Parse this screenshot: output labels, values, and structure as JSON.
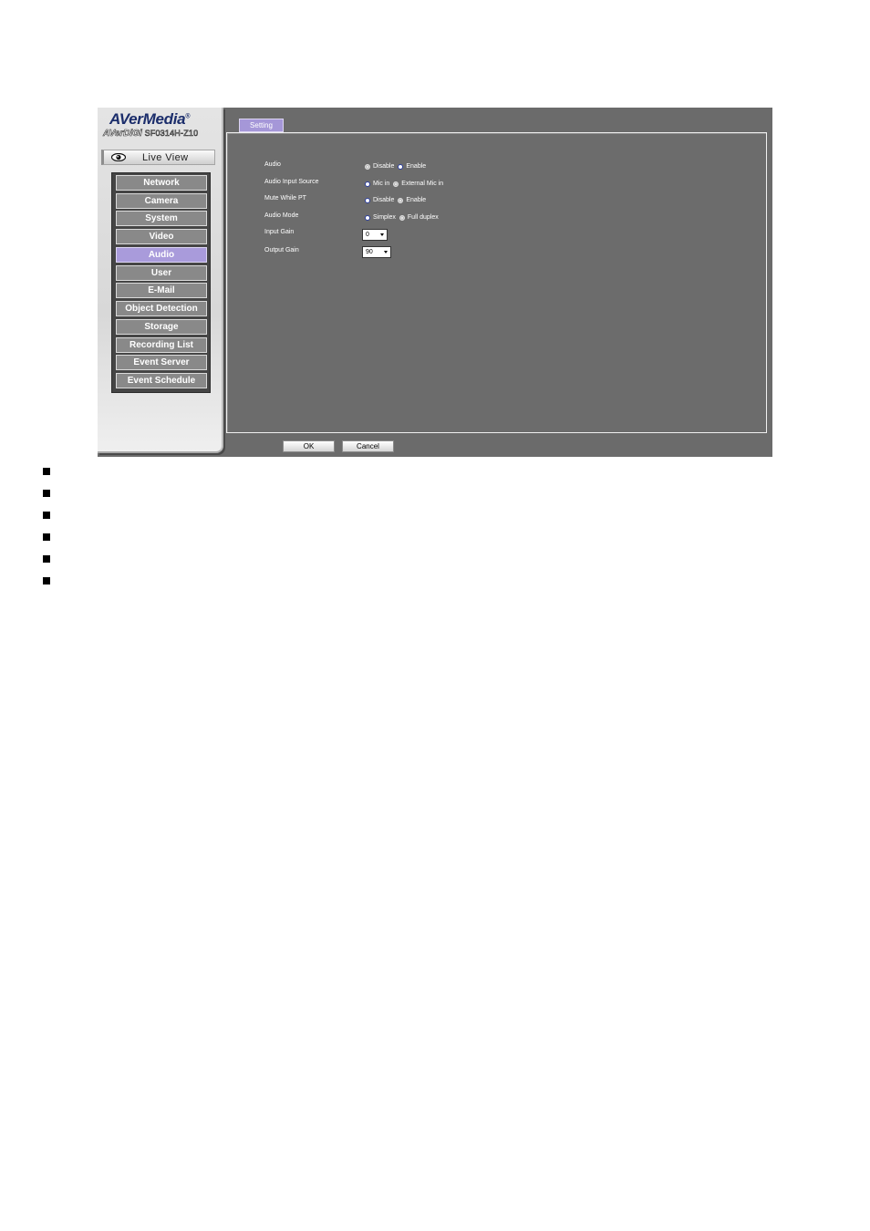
{
  "logo": {
    "brand": "AVerMedia",
    "registered": "®",
    "sub_brand": "AVerDiGi",
    "model": "SF0314H-Z10"
  },
  "live_view": {
    "label": "Live View",
    "icon": "eye-icon"
  },
  "menu": {
    "items": [
      {
        "label": "Network",
        "active": false
      },
      {
        "label": "Camera",
        "active": false
      },
      {
        "label": "System",
        "active": false
      },
      {
        "label": "Video",
        "active": false
      },
      {
        "label": "Audio",
        "active": true
      },
      {
        "label": "User",
        "active": false
      },
      {
        "label": "E-Mail",
        "active": false
      },
      {
        "label": "Object Detection",
        "active": false
      },
      {
        "label": "Storage",
        "active": false
      },
      {
        "label": "Recording List",
        "active": false
      },
      {
        "label": "Event Server",
        "active": false
      },
      {
        "label": "Event Schedule",
        "active": false
      }
    ]
  },
  "tab": {
    "label": "Setting"
  },
  "settings": {
    "audio": {
      "label": "Audio",
      "options": [
        "Disable",
        "Enable"
      ],
      "selected": "Enable"
    },
    "audio_input_source": {
      "label": "Audio Input Source",
      "options": [
        "Mic in",
        "External Mic in"
      ],
      "selected": "Mic in"
    },
    "mute_while_pt": {
      "label": "Mute While PT",
      "options": [
        "Disable",
        "Enable"
      ],
      "selected": "Disable"
    },
    "audio_mode": {
      "label": "Audio Mode",
      "options": [
        "Simplex",
        "Full duplex"
      ],
      "selected": "Simplex"
    },
    "input_gain": {
      "label": "Input Gain",
      "value": "0"
    },
    "output_gain": {
      "label": "Output Gain",
      "value": "90"
    }
  },
  "buttons": {
    "ok": "OK",
    "cancel": "Cancel"
  },
  "colors": {
    "active_menu": "#a99bdb",
    "tab": "#a597d8",
    "panel": "#6c6c6c",
    "menu_item": "#898989"
  }
}
